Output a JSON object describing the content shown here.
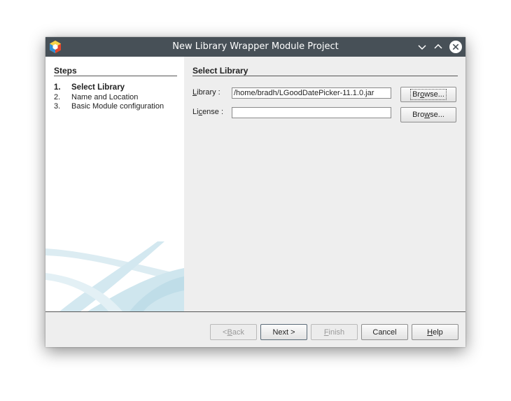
{
  "window": {
    "title": "New Library Wrapper Module Project",
    "title_icons": [
      "minimize-chevron-icon",
      "maximize-chevron-icon",
      "close-circle-icon"
    ]
  },
  "steps": {
    "heading": "Steps",
    "items": [
      {
        "num": "1.",
        "label": "Select Library",
        "current": true
      },
      {
        "num": "2.",
        "label": "Name and Location",
        "current": false
      },
      {
        "num": "3.",
        "label": "Basic Module configuration",
        "current": false
      }
    ]
  },
  "main": {
    "heading": "Select Library",
    "library": {
      "label_mnemonic": "L",
      "label_rest": "ibrary :",
      "value": "/home/bradh/LGoodDatePicker-11.1.0.jar",
      "browse_pre": "Br",
      "browse_mnemonic": "o",
      "browse_post": "wse..."
    },
    "license": {
      "label_pre": "Li",
      "label_mnemonic": "c",
      "label_rest": "ense :",
      "value": "",
      "browse_pre": "Bro",
      "browse_mnemonic": "w",
      "browse_post": "se..."
    }
  },
  "footer": {
    "back_pre": "< ",
    "back_mnemonic": "B",
    "back_post": "ack",
    "next": "Next >",
    "finish_mnemonic": "F",
    "finish_post": "inish",
    "cancel": "Cancel",
    "help_mnemonic": "H",
    "help_post": "elp"
  },
  "colors": {
    "titlebar": "#475057",
    "dialog_bg": "#eeeeee",
    "steps_bg": "#ffffff",
    "decor": "#cfe6ee"
  }
}
